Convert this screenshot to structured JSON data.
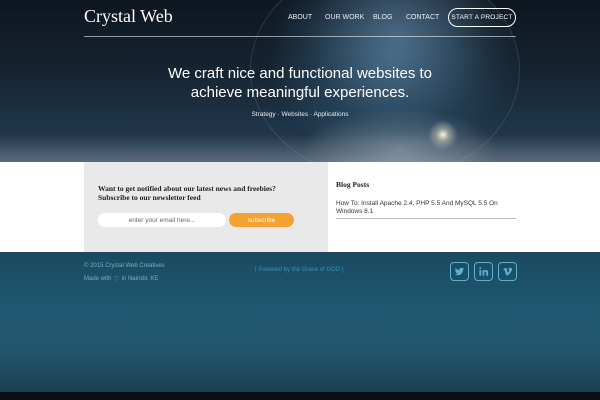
{
  "header": {
    "brand": "Crystal Web",
    "nav": [
      "ABOUT",
      "OUR WORK",
      "BLOG",
      "CONTACT"
    ],
    "cta_label": "START A PROJECT"
  },
  "hero": {
    "tagline_line1": "We craft nice and functional websites to",
    "tagline_line2": "achieve meaningful experiences.",
    "services": "Strategy · Websites · Applications"
  },
  "newsletter": {
    "title": "Want to get notified about our latest news and freebies? Subscribe to our newsletter feed",
    "input_placeholder": "enter your email here...",
    "button_label": "subscribe"
  },
  "blog": {
    "title": "Blog Posts",
    "posts": [
      "How To: Install Apache 2.4, PHP 5.5 And MySQL 5.5 On Windows 8.1"
    ]
  },
  "footer": {
    "copyright": "© 2015 Crystal Web Creatives",
    "made_prefix": "Made with",
    "made_suffix": "in Nairobi, KE",
    "powered": "[ Powered by the Grace of GOD ]",
    "social": [
      "twitter-icon",
      "linkedin-icon",
      "vimeo-icon"
    ]
  },
  "colors": {
    "accent": "#f5a233",
    "footer_text": "#6fb2cc",
    "footer_bg": "#1f5870"
  }
}
